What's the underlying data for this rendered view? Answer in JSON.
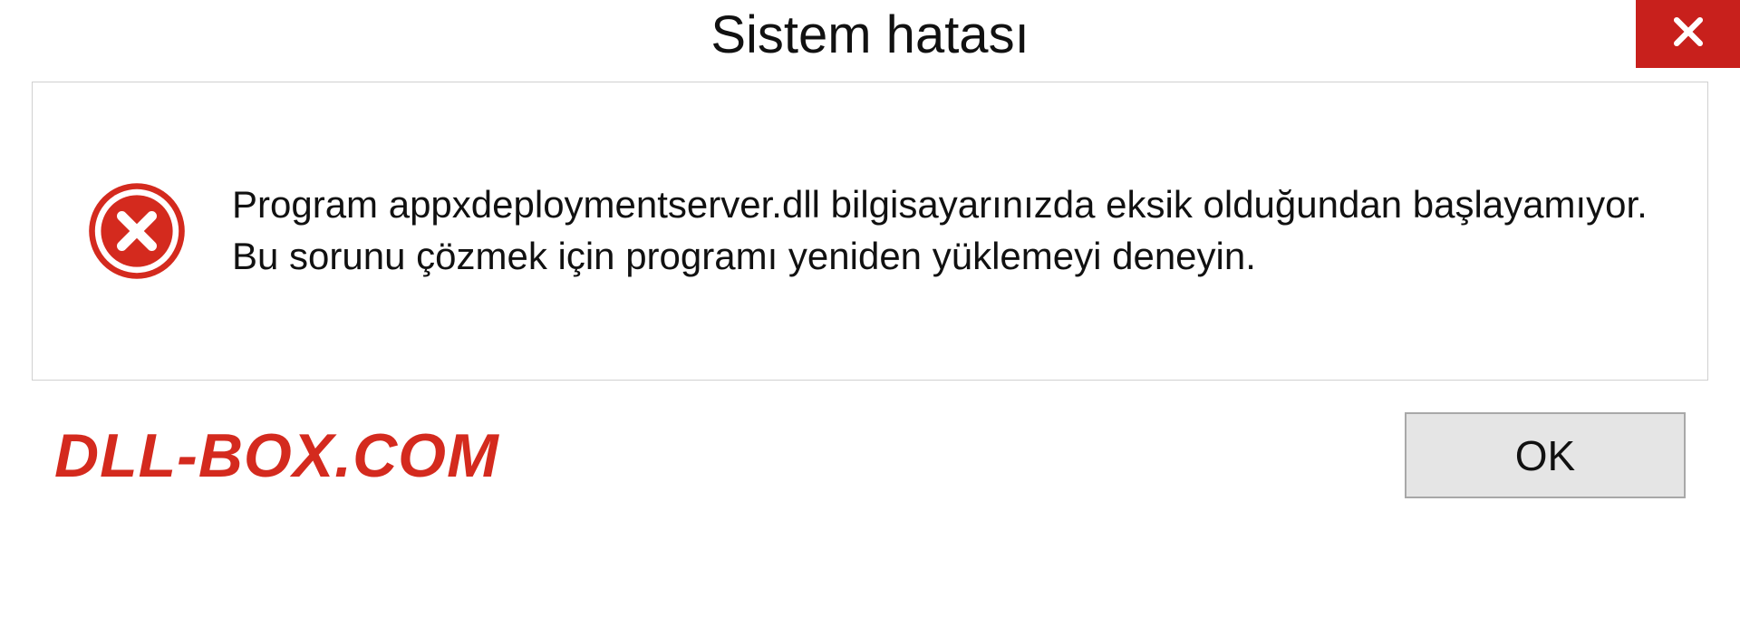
{
  "title": "Sistem hatası",
  "message": "Program appxdeploymentserver.dll bilgisayarınızda eksik olduğundan başlayamıyor. Bu sorunu çözmek için programı yeniden yüklemeyi deneyin.",
  "ok_label": "OK",
  "watermark": "DLL-BOX.COM",
  "colors": {
    "close_bg": "#c8201c",
    "watermark": "#d42a1e",
    "error_icon": "#d42a1e"
  }
}
